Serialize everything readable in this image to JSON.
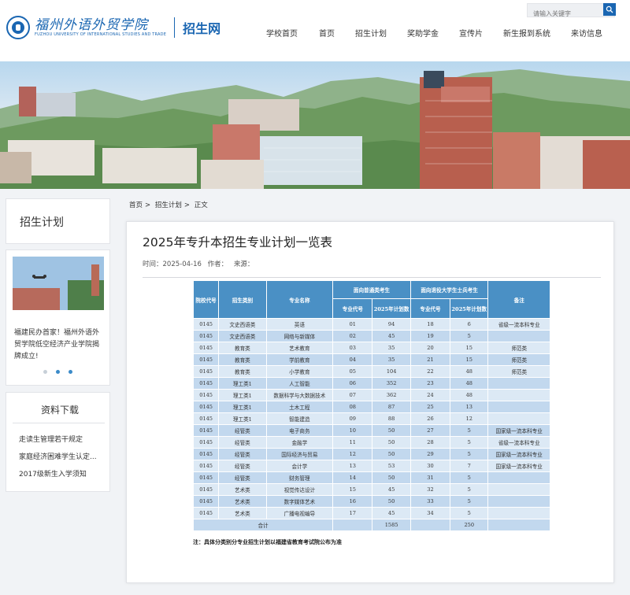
{
  "header": {
    "logo_cn": "福州外语外贸学院",
    "logo_en": "FUZHOU UNIVERSITY OF INTERNATIONAL STUDIES AND TRADE",
    "site_name": "招生网",
    "search_placeholder": "请输入关键字",
    "nav": [
      "学校首页",
      "首页",
      "招生计划",
      "奖助学金",
      "宣传片",
      "新生报到系统",
      "来访信息"
    ]
  },
  "sidebar": {
    "section_title": "招生计划",
    "news_caption": "福建民办首家！福州外语外贸学院低空经济产业学院揭牌成立!",
    "downloads_title": "资料下载",
    "downloads": [
      "走读生管理若干规定",
      "家庭经济困难学生认定...",
      "2017级新生入学须知"
    ]
  },
  "breadcrumb": [
    "首页",
    "招生计划",
    "正文"
  ],
  "article": {
    "title": "2025年专升本招生专业计划一览表",
    "time_label": "时间：",
    "time": "2025-04-16",
    "author_label": "作者：",
    "source_label": "来源："
  },
  "table": {
    "headers": {
      "school_code": "院校代号",
      "category": "招生类别",
      "major": "专业名称",
      "group1": "面向普通类考生",
      "group2": "面向退役大学生士兵考生",
      "code": "专业代号",
      "plan": "2025年计划数",
      "remark": "备注"
    },
    "rows": [
      [
        "0145",
        "文史西语类",
        "英语",
        "01",
        "94",
        "18",
        "6",
        "省级一流本科专业"
      ],
      [
        "0145",
        "文史西语类",
        "网络与新媒体",
        "02",
        "45",
        "19",
        "5",
        ""
      ],
      [
        "0145",
        "教育类",
        "艺术教育",
        "03",
        "35",
        "20",
        "15",
        "师范类"
      ],
      [
        "0145",
        "教育类",
        "学前教育",
        "04",
        "35",
        "21",
        "15",
        "师范类"
      ],
      [
        "0145",
        "教育类",
        "小学教育",
        "05",
        "104",
        "22",
        "48",
        "师范类"
      ],
      [
        "0145",
        "理工类1",
        "人工智能",
        "06",
        "352",
        "23",
        "48",
        ""
      ],
      [
        "0145",
        "理工类1",
        "数据科学与大数据技术",
        "07",
        "362",
        "24",
        "48",
        ""
      ],
      [
        "0145",
        "理工类1",
        "土木工程",
        "08",
        "87",
        "25",
        "13",
        ""
      ],
      [
        "0145",
        "理工类1",
        "智能建造",
        "09",
        "88",
        "26",
        "12",
        ""
      ],
      [
        "0145",
        "经管类",
        "电子商务",
        "10",
        "50",
        "27",
        "5",
        "国家级一流本科专业"
      ],
      [
        "0145",
        "经管类",
        "金融学",
        "11",
        "50",
        "28",
        "5",
        "省级一流本科专业"
      ],
      [
        "0145",
        "经管类",
        "国际经济与贸易",
        "12",
        "50",
        "29",
        "5",
        "国家级一流本科专业"
      ],
      [
        "0145",
        "经管类",
        "会计学",
        "13",
        "53",
        "30",
        "7",
        "国家级一流本科专业"
      ],
      [
        "0145",
        "经管类",
        "财务管理",
        "14",
        "50",
        "31",
        "5",
        ""
      ],
      [
        "0145",
        "艺术类",
        "视觉传达设计",
        "15",
        "45",
        "32",
        "5",
        ""
      ],
      [
        "0145",
        "艺术类",
        "数字媒体艺术",
        "16",
        "50",
        "33",
        "5",
        ""
      ],
      [
        "0145",
        "艺术类",
        "广播电视编导",
        "17",
        "45",
        "34",
        "5",
        ""
      ]
    ],
    "total_label": "合计",
    "total_plan1": "1585",
    "total_plan2": "250",
    "note": "注：具体分类别分专业招生计划以福建省教育考试院公布为准"
  },
  "colors": {
    "brand": "#1a66b2",
    "table_header": "#4a90c5",
    "row_light": "#dce9f5",
    "row_dark": "#c2d8ee"
  }
}
